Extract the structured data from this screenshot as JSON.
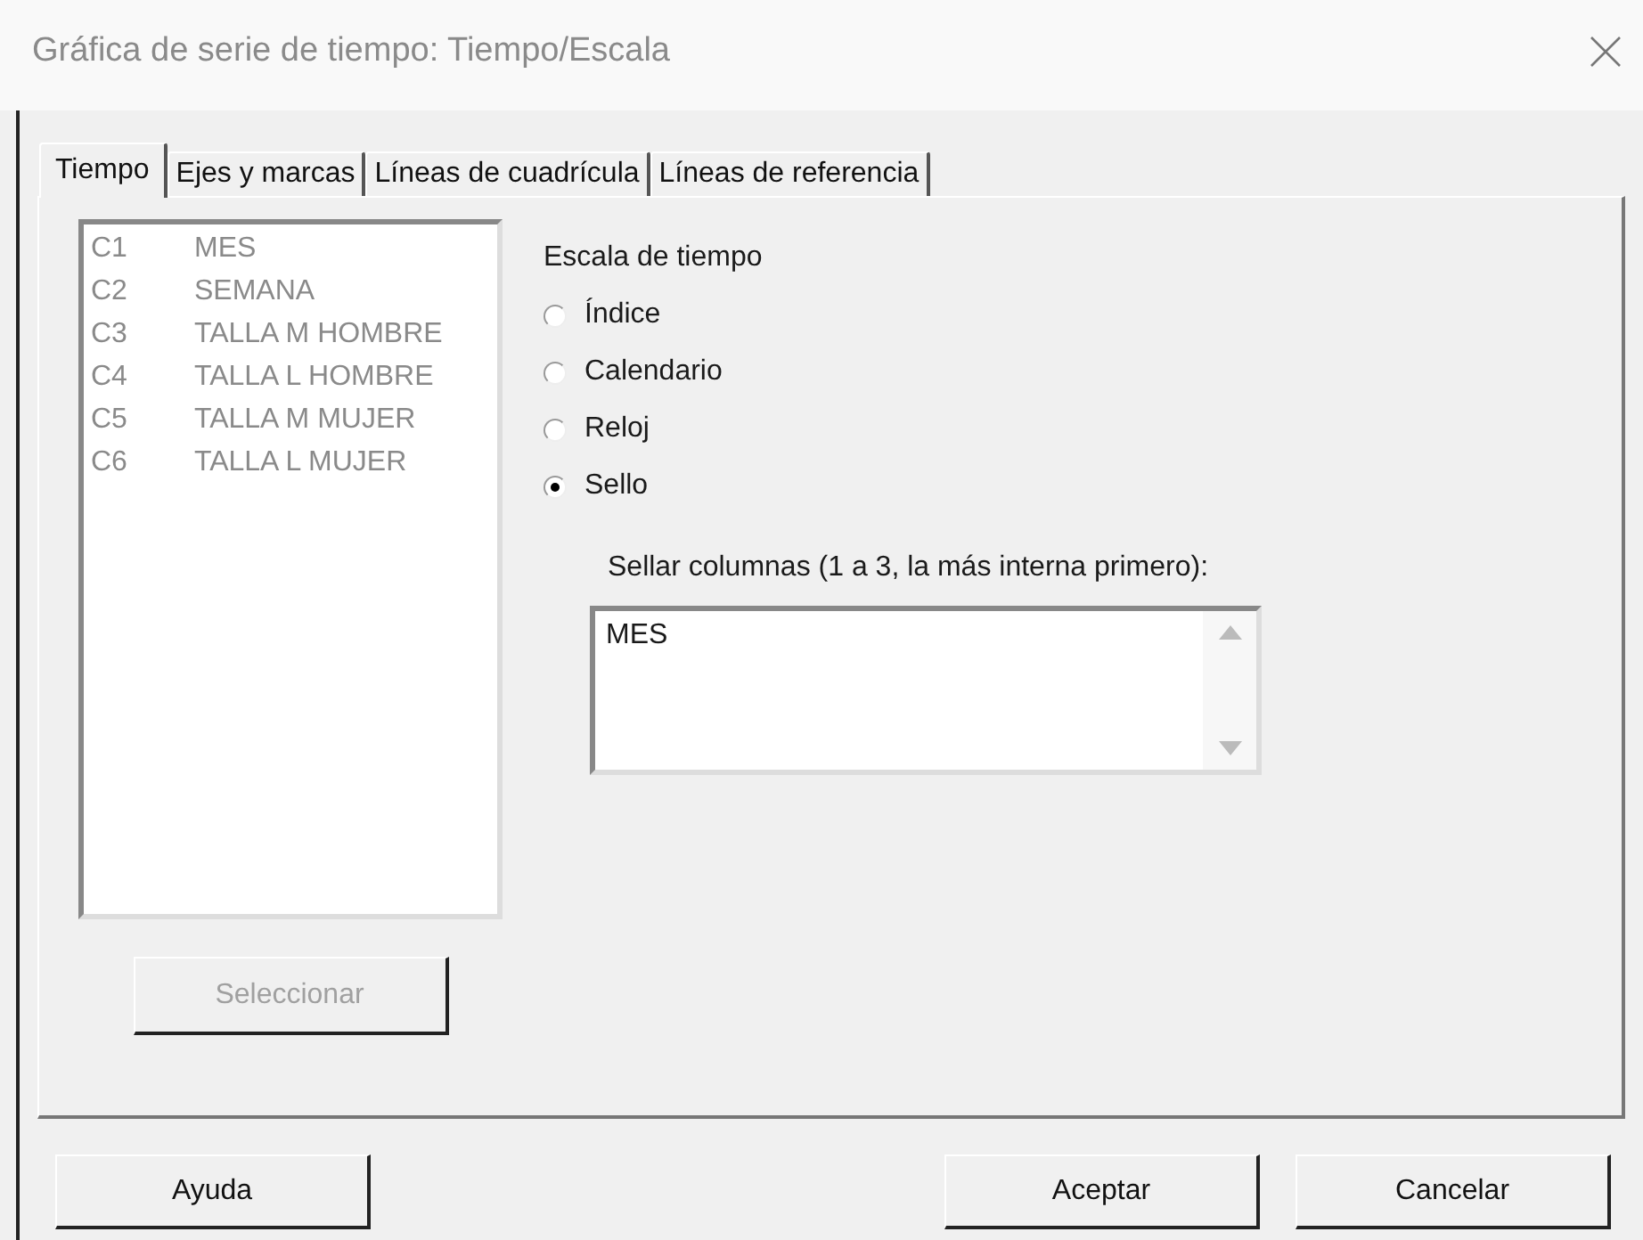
{
  "window": {
    "title": "Gráfica de serie de tiempo: Tiempo/Escala"
  },
  "tabs": [
    {
      "label": "Tiempo",
      "selected": true
    },
    {
      "label": "Ejes y marcas",
      "selected": false
    },
    {
      "label": "Líneas de cuadrícula",
      "selected": false
    },
    {
      "label": "Líneas de referencia",
      "selected": false
    }
  ],
  "columns_list": [
    {
      "column": "C1",
      "name": "MES"
    },
    {
      "column": "C2",
      "name": "SEMANA"
    },
    {
      "column": "C3",
      "name": "TALLA M HOMBRE"
    },
    {
      "column": "C4",
      "name": "TALLA L HOMBRE"
    },
    {
      "column": "C5",
      "name": "TALLA M MUJER"
    },
    {
      "column": "C6",
      "name": "TALLA L MUJER"
    }
  ],
  "select_button": {
    "label": "Seleccionar",
    "disabled": true
  },
  "time_scale": {
    "label": "Escala de tiempo",
    "options": [
      {
        "label": "Índice",
        "selected": false
      },
      {
        "label": "Calendario",
        "selected": false
      },
      {
        "label": "Reloj",
        "selected": false
      },
      {
        "label": "Sello",
        "selected": true
      }
    ]
  },
  "stamp_columns": {
    "label": "Sellar columnas (1 a 3, la más interna primero):",
    "value": "MES"
  },
  "buttons": [
    {
      "label": "Ayuda",
      "kind": "help"
    },
    {
      "label": "Aceptar",
      "kind": "ok"
    },
    {
      "label": "Cancelar",
      "kind": "cancel"
    }
  ]
}
